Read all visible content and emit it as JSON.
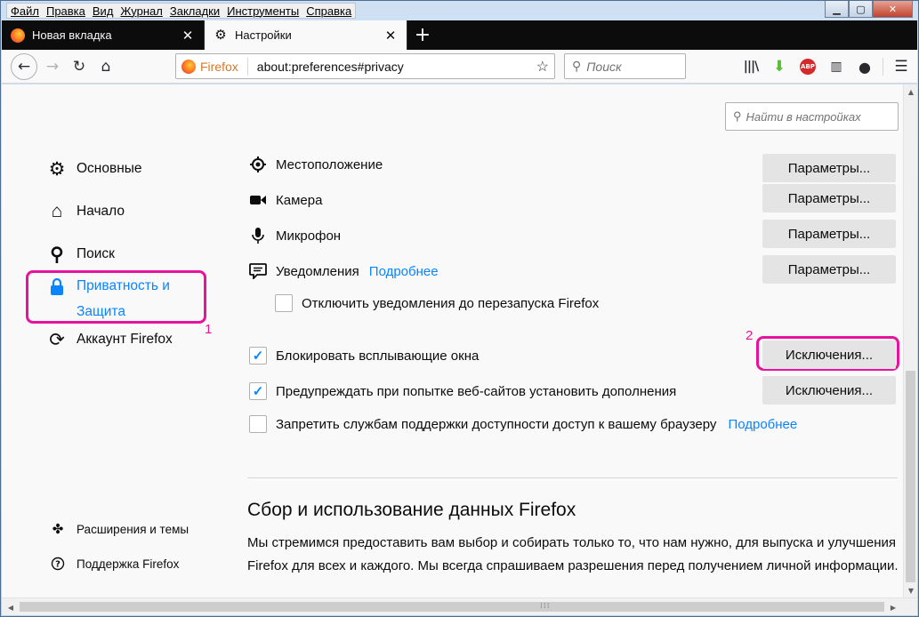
{
  "menubar": {
    "items": [
      "Файл",
      "Правка",
      "Вид",
      "Журнал",
      "Закладки",
      "Инструменты",
      "Справка"
    ]
  },
  "tabs": [
    {
      "label": "Новая вкладка",
      "active": false,
      "icon": "firefox-icon"
    },
    {
      "label": "Настройки",
      "active": true,
      "icon": "gear-icon"
    }
  ],
  "navbar": {
    "identity_label": "Firefox",
    "url": "about:preferences#privacy",
    "search_placeholder": "Поиск"
  },
  "content": {
    "find_placeholder": "Найти в настройках",
    "sidebar": {
      "categories": [
        {
          "label": "Основные",
          "icon": "gear-icon"
        },
        {
          "label": "Начало",
          "icon": "home-icon"
        },
        {
          "label": "Поиск",
          "icon": "search-icon"
        },
        {
          "label": "Приватность и Защита",
          "line1": "Приватность и",
          "line2": "Защита",
          "icon": "lock-icon",
          "selected": true
        },
        {
          "label": "Аккаунт Firefox",
          "icon": "sync-icon"
        }
      ],
      "footer": [
        {
          "label": "Расширения и темы",
          "icon": "puzzle-icon"
        },
        {
          "label": "Поддержка Firefox",
          "icon": "help-icon"
        }
      ]
    },
    "annotations": {
      "one": "1",
      "two": "2"
    },
    "permissions": [
      {
        "label": "Местоположение",
        "icon": "location-icon",
        "button": "Параметры..."
      },
      {
        "label": "Камера",
        "icon": "camera-icon",
        "button": "Параметры..."
      },
      {
        "label": "Микрофон",
        "icon": "microphone-icon",
        "button": "Параметры..."
      },
      {
        "label": "Уведомления",
        "icon": "notification-icon",
        "link": "Подробнее",
        "button": "Параметры..."
      }
    ],
    "checkboxes": [
      {
        "label": "Отключить уведомления до перезапуска Firefox",
        "checked": false
      },
      {
        "label": "Блокировать всплывающие окна",
        "checked": true,
        "button": "Исключения..."
      },
      {
        "label": "Предупреждать при попытке веб-сайтов установить дополнения",
        "checked": true,
        "button": "Исключения..."
      },
      {
        "label": "Запретить службам поддержки доступности доступ к вашему браузеру",
        "checked": false,
        "link": "Подробнее"
      }
    ],
    "section": {
      "title": "Сбор и использование данных Firefox",
      "text": "Мы стремимся предоставить вам выбор и собирать только то, что нам нужно, для выпуска и улучшения Firefox для всех и каждого. Мы всегда спрашиваем разрешения перед получением личной информации."
    }
  },
  "colors": {
    "accent": "#0a84ff",
    "highlight": "#e8139c",
    "tabstrip": "#0c0c0d"
  }
}
